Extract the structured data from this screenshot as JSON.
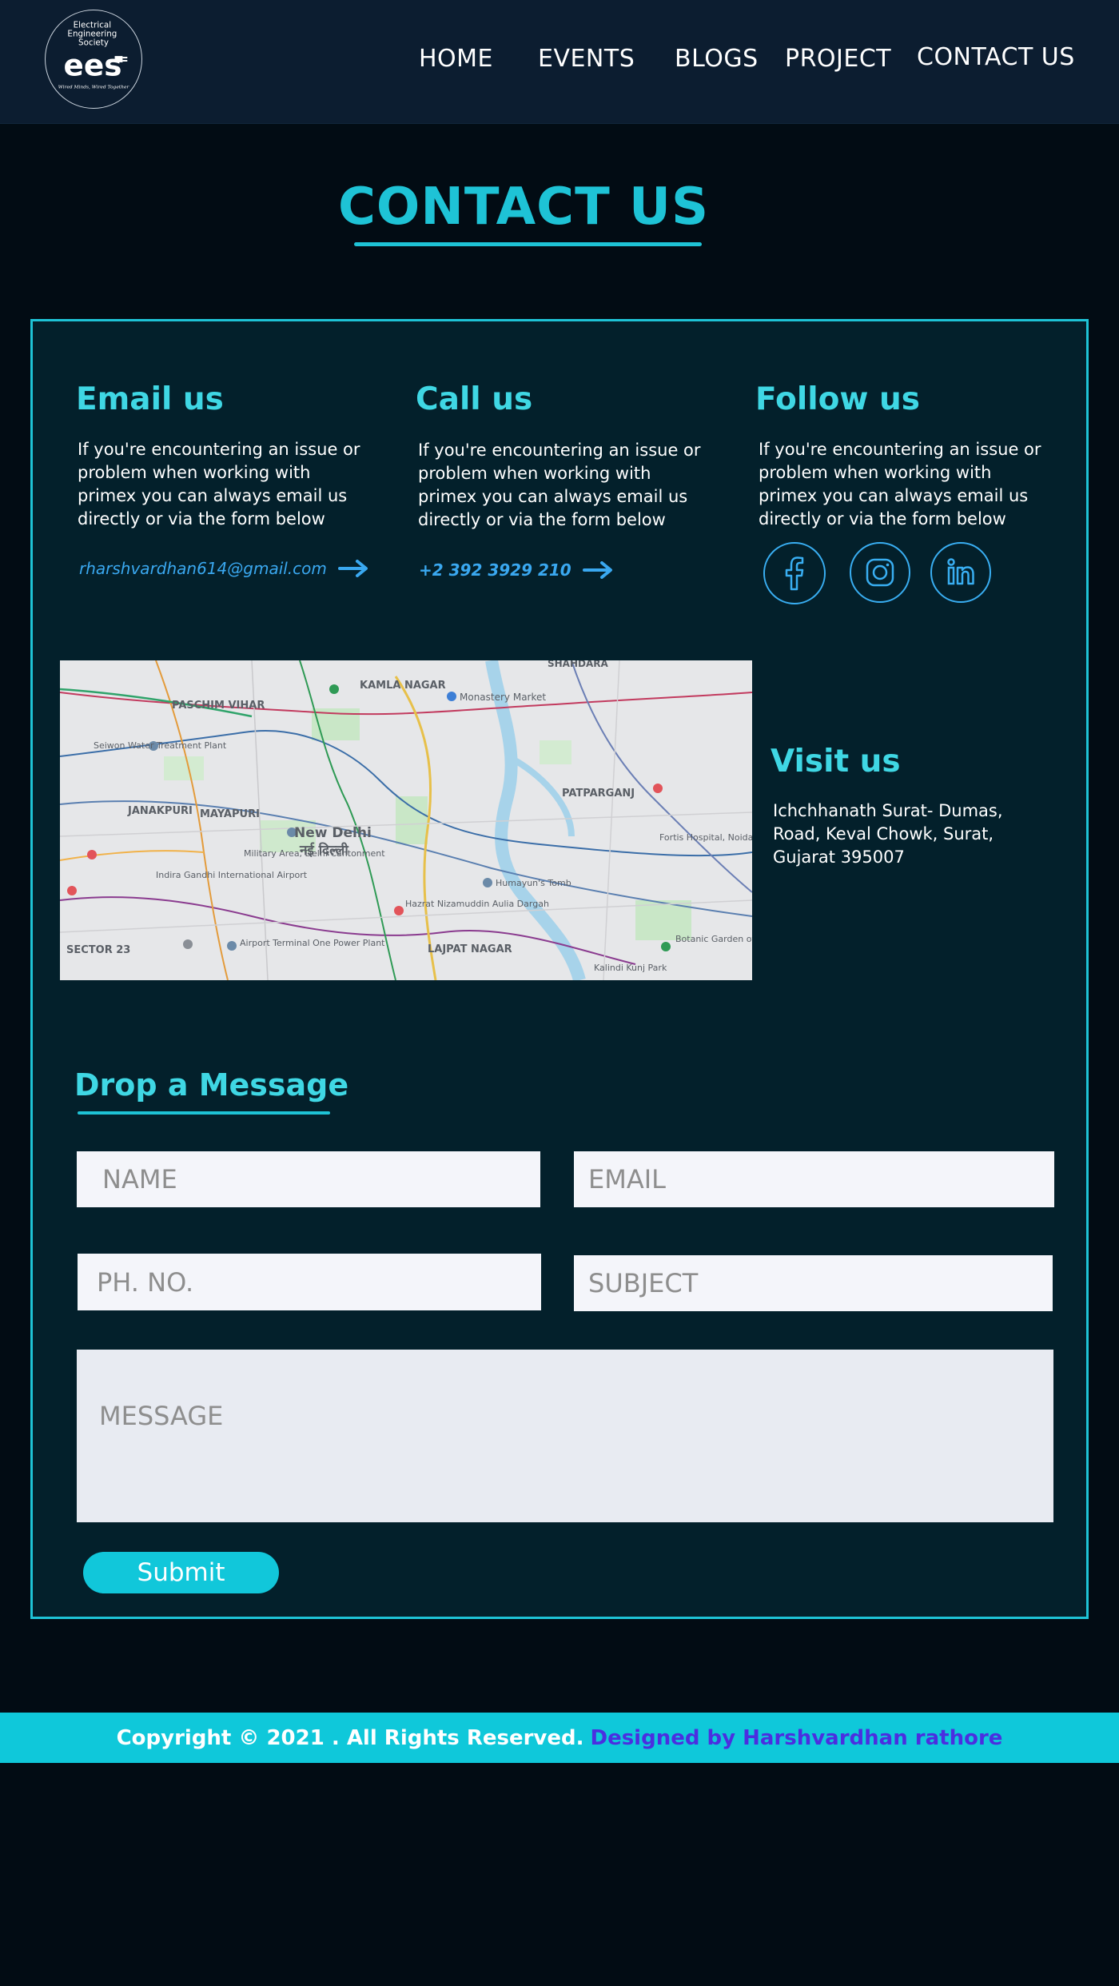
{
  "nav": {
    "logo": {
      "top_text": "Electrical Engineering Society",
      "mark": "ees",
      "motto": "Wired Minds, Wired Together"
    },
    "items": [
      {
        "label": "HOME"
      },
      {
        "label": "EVENTS"
      },
      {
        "label": "BLOGS"
      },
      {
        "label": "PROJECT"
      },
      {
        "label": "CONTACT US"
      }
    ]
  },
  "page": {
    "title": "CONTACT US"
  },
  "contact": {
    "email": {
      "title": "Email us",
      "text": "If you're encountering an issue or problem when working with primex you can always email us directly or via the form below",
      "link": "rharshvardhan614@gmail.com"
    },
    "call": {
      "title": "Call us",
      "text": "If you're encountering an issue or problem when working with primex you can always email us directly or via the form below",
      "link": "+2 392 3929 210"
    },
    "follow": {
      "title": "Follow us",
      "text": "If you're encountering an issue or problem when working with primex you can always email us directly or via the form below",
      "icons": [
        "facebook-icon",
        "instagram-icon",
        "linkedin-icon"
      ]
    },
    "visit": {
      "title": "Visit us",
      "address": "Ichchhanath Surat- Dumas, Road, Keval Chowk, Surat, Gujarat 395007"
    }
  },
  "map": {
    "labels": {
      "center_en": "New Delhi",
      "center_hi": "नई दिल्ली",
      "paschim_vihar": "PASCHIM VIHAR",
      "kamla_nagar": "KAMLA NAGAR",
      "shahdara": "SHAHDARA",
      "janakpuri": "JANAKPURI",
      "mayapuri": "MAYAPURI",
      "patparganj": "PATPARGANJ",
      "monastery_market": "Monastery Market",
      "military_area": "Military Area, Delhi Cantonment",
      "airport": "Indira Gandhi International Airport",
      "airport_terminal": "Airport Terminal One Power Plant",
      "humayun": "Humayun's Tomb",
      "nizamuddin": "Hazrat Nizamuddin Aulia Dargah",
      "lajpat": "LAJPAT NAGAR",
      "sector23": "SECTOR 23",
      "seiwon": "Seiwon Water Treatment Plant",
      "botanic": "Botanic Garden of Indian Republic",
      "kalindi": "Kalindi Kunj Park",
      "fortis": "Fortis Hospital, Noida"
    }
  },
  "form": {
    "title": "Drop a Message",
    "name_placeholder": "NAME",
    "email_placeholder": "EMAIL",
    "phone_placeholder": "PH. NO.",
    "subject_placeholder": "SUBJECT",
    "message_placeholder": "MESSAGE",
    "submit_label": "Submit"
  },
  "footer": {
    "copyright": "Copyright © 2021 . All Rights Reserved.",
    "credit": "Designed by Harshvardhan rathore"
  },
  "colors": {
    "accent": "#1ec3d6",
    "link": "#3aa8f0",
    "background": "#020c14",
    "panel": "#03202b",
    "nav": "#0c1d30",
    "credit": "#4b2ee0"
  }
}
